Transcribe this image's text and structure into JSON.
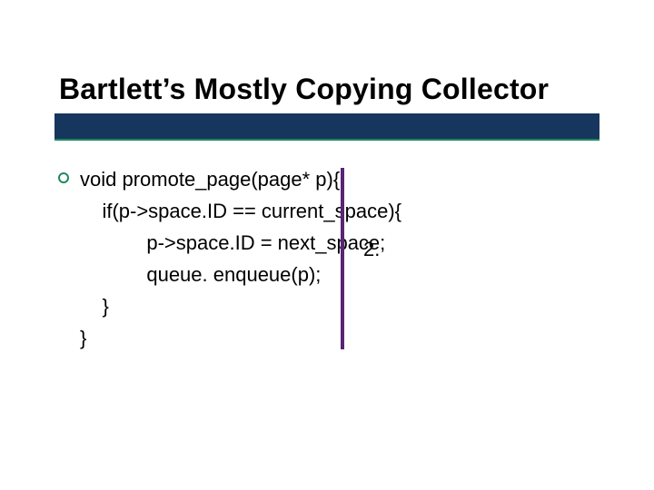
{
  "slide": {
    "title": "Bartlett’s Mostly Copying Collector",
    "code": {
      "l1": "void promote_page(page* p){",
      "l2": "    if(p->space.ID == current_space){",
      "l3": "            p->space.ID = next_space;",
      "l4": "            queue. enqueue(p);",
      "l5": "    }",
      "l6": "}"
    },
    "annotation": "2."
  },
  "colors": {
    "underline_dark": "#17365d",
    "underline_accent": "#1f8a5b",
    "vline": "#5a2477"
  }
}
